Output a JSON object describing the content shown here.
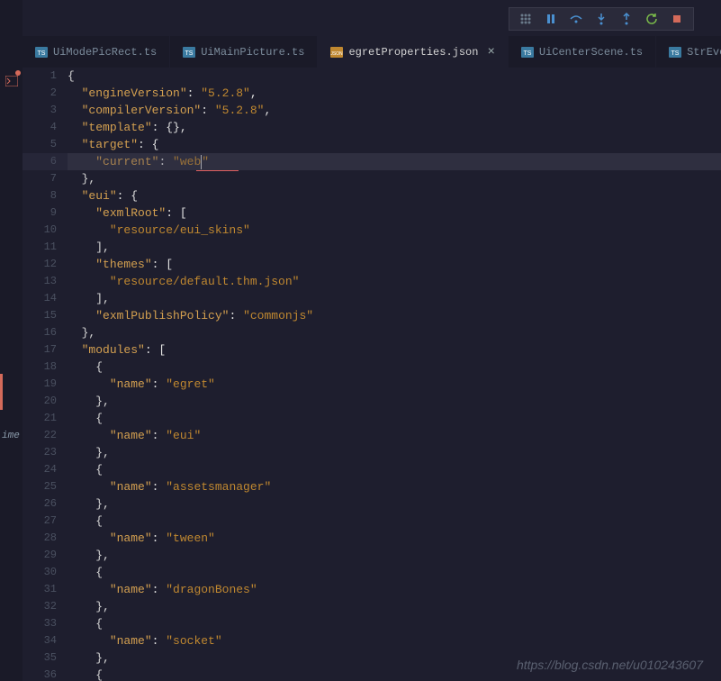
{
  "toolbar": {
    "icons": [
      "drag",
      "pause",
      "step-over",
      "step-into",
      "step-out",
      "restart",
      "stop"
    ]
  },
  "tabs": [
    {
      "label": "UiModePicRect.ts",
      "icon": "ts",
      "active": false
    },
    {
      "label": "UiMainPicture.ts",
      "icon": "ts",
      "active": false
    },
    {
      "label": "egretProperties.json",
      "icon": "json",
      "active": true,
      "closable": true
    },
    {
      "label": "UiCenterScene.ts",
      "icon": "ts",
      "active": false
    },
    {
      "label": "StrEvent.ts",
      "icon": "ts",
      "active": false
    }
  ],
  "gutter": {
    "start": 1,
    "end": 36
  },
  "code": {
    "lines": [
      {
        "n": 1,
        "tokens": [
          {
            "t": "b",
            "v": "{"
          }
        ]
      },
      {
        "n": 2,
        "tokens": [
          {
            "t": "b",
            "v": "  "
          },
          {
            "t": "k",
            "v": "\"engineVersion\""
          },
          {
            "t": "p",
            "v": ": "
          },
          {
            "t": "s",
            "v": "\"5.2.8\""
          },
          {
            "t": "p",
            "v": ","
          }
        ]
      },
      {
        "n": 3,
        "tokens": [
          {
            "t": "b",
            "v": "  "
          },
          {
            "t": "k",
            "v": "\"compilerVersion\""
          },
          {
            "t": "p",
            "v": ": "
          },
          {
            "t": "s",
            "v": "\"5.2.8\""
          },
          {
            "t": "p",
            "v": ","
          }
        ]
      },
      {
        "n": 4,
        "tokens": [
          {
            "t": "b",
            "v": "  "
          },
          {
            "t": "k",
            "v": "\"template\""
          },
          {
            "t": "p",
            "v": ": {},"
          }
        ]
      },
      {
        "n": 5,
        "tokens": [
          {
            "t": "b",
            "v": "  "
          },
          {
            "t": "k",
            "v": "\"target\""
          },
          {
            "t": "p",
            "v": ": {"
          }
        ]
      },
      {
        "n": 6,
        "highlighted": true,
        "tokens": [
          {
            "t": "b",
            "v": "    "
          },
          {
            "t": "k",
            "v": "\"current\""
          },
          {
            "t": "p",
            "v": ": "
          },
          {
            "t": "s",
            "v": "\"web"
          },
          {
            "t": "cursor",
            "v": ""
          },
          {
            "t": "s",
            "v": "\""
          }
        ]
      },
      {
        "n": 7,
        "tokens": [
          {
            "t": "b",
            "v": "  },"
          }
        ]
      },
      {
        "n": 8,
        "tokens": [
          {
            "t": "b",
            "v": "  "
          },
          {
            "t": "k",
            "v": "\"eui\""
          },
          {
            "t": "p",
            "v": ": {"
          }
        ]
      },
      {
        "n": 9,
        "tokens": [
          {
            "t": "b",
            "v": "    "
          },
          {
            "t": "k",
            "v": "\"exmlRoot\""
          },
          {
            "t": "p",
            "v": ": ["
          }
        ]
      },
      {
        "n": 10,
        "tokens": [
          {
            "t": "b",
            "v": "      "
          },
          {
            "t": "s",
            "v": "\"resource/eui_skins\""
          }
        ]
      },
      {
        "n": 11,
        "tokens": [
          {
            "t": "b",
            "v": "    ],"
          }
        ]
      },
      {
        "n": 12,
        "tokens": [
          {
            "t": "b",
            "v": "    "
          },
          {
            "t": "k",
            "v": "\"themes\""
          },
          {
            "t": "p",
            "v": ": ["
          }
        ]
      },
      {
        "n": 13,
        "tokens": [
          {
            "t": "b",
            "v": "      "
          },
          {
            "t": "s",
            "v": "\"resource/default.thm.json\""
          }
        ]
      },
      {
        "n": 14,
        "tokens": [
          {
            "t": "b",
            "v": "    ],"
          }
        ]
      },
      {
        "n": 15,
        "tokens": [
          {
            "t": "b",
            "v": "    "
          },
          {
            "t": "k",
            "v": "\"exmlPublishPolicy\""
          },
          {
            "t": "p",
            "v": ": "
          },
          {
            "t": "s",
            "v": "\"commonjs\""
          }
        ]
      },
      {
        "n": 16,
        "tokens": [
          {
            "t": "b",
            "v": "  },"
          }
        ]
      },
      {
        "n": 17,
        "tokens": [
          {
            "t": "b",
            "v": "  "
          },
          {
            "t": "k",
            "v": "\"modules\""
          },
          {
            "t": "p",
            "v": ": ["
          }
        ]
      },
      {
        "n": 18,
        "tokens": [
          {
            "t": "b",
            "v": "    {"
          }
        ]
      },
      {
        "n": 19,
        "tokens": [
          {
            "t": "b",
            "v": "      "
          },
          {
            "t": "k",
            "v": "\"name\""
          },
          {
            "t": "p",
            "v": ": "
          },
          {
            "t": "s",
            "v": "\"egret\""
          }
        ]
      },
      {
        "n": 20,
        "tokens": [
          {
            "t": "b",
            "v": "    },"
          }
        ]
      },
      {
        "n": 21,
        "tokens": [
          {
            "t": "b",
            "v": "    {"
          }
        ]
      },
      {
        "n": 22,
        "tokens": [
          {
            "t": "b",
            "v": "      "
          },
          {
            "t": "k",
            "v": "\"name\""
          },
          {
            "t": "p",
            "v": ": "
          },
          {
            "t": "s",
            "v": "\"eui\""
          }
        ]
      },
      {
        "n": 23,
        "tokens": [
          {
            "t": "b",
            "v": "    },"
          }
        ]
      },
      {
        "n": 24,
        "tokens": [
          {
            "t": "b",
            "v": "    {"
          }
        ]
      },
      {
        "n": 25,
        "tokens": [
          {
            "t": "b",
            "v": "      "
          },
          {
            "t": "k",
            "v": "\"name\""
          },
          {
            "t": "p",
            "v": ": "
          },
          {
            "t": "s",
            "v": "\"assetsmanager\""
          }
        ]
      },
      {
        "n": 26,
        "tokens": [
          {
            "t": "b",
            "v": "    },"
          }
        ]
      },
      {
        "n": 27,
        "tokens": [
          {
            "t": "b",
            "v": "    {"
          }
        ]
      },
      {
        "n": 28,
        "tokens": [
          {
            "t": "b",
            "v": "      "
          },
          {
            "t": "k",
            "v": "\"name\""
          },
          {
            "t": "p",
            "v": ": "
          },
          {
            "t": "s",
            "v": "\"tween\""
          }
        ]
      },
      {
        "n": 29,
        "tokens": [
          {
            "t": "b",
            "v": "    },"
          }
        ]
      },
      {
        "n": 30,
        "tokens": [
          {
            "t": "b",
            "v": "    {"
          }
        ]
      },
      {
        "n": 31,
        "tokens": [
          {
            "t": "b",
            "v": "      "
          },
          {
            "t": "k",
            "v": "\"name\""
          },
          {
            "t": "p",
            "v": ": "
          },
          {
            "t": "s",
            "v": "\"dragonBones\""
          }
        ]
      },
      {
        "n": 32,
        "tokens": [
          {
            "t": "b",
            "v": "    },"
          }
        ]
      },
      {
        "n": 33,
        "tokens": [
          {
            "t": "b",
            "v": "    {"
          }
        ]
      },
      {
        "n": 34,
        "tokens": [
          {
            "t": "b",
            "v": "      "
          },
          {
            "t": "k",
            "v": "\"name\""
          },
          {
            "t": "p",
            "v": ": "
          },
          {
            "t": "s",
            "v": "\"socket\""
          }
        ]
      },
      {
        "n": 35,
        "tokens": [
          {
            "t": "b",
            "v": "    },"
          }
        ]
      },
      {
        "n": 36,
        "tokens": [
          {
            "t": "b",
            "v": "    {"
          }
        ]
      }
    ]
  },
  "sideLabel": "ime",
  "watermark": "https://blog.csdn.net/u010243607"
}
